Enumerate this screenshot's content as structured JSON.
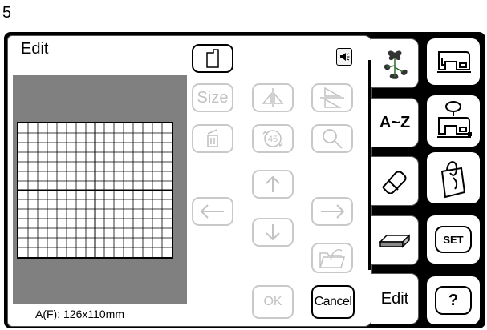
{
  "page_number": "5",
  "screen": {
    "title": "Edit",
    "size_readout": "A(F): 126x110mm",
    "buttons": {
      "size": "Size",
      "ok": "OK",
      "cancel": "Cancel",
      "rotate_angle": "45"
    },
    "tabs": {
      "text_tab": "A~Z",
      "edit_tab": "Edit"
    },
    "side_buttons": {
      "set": "SET",
      "help": "?"
    }
  },
  "icons": {
    "template": "template-icon",
    "speaker": "speaker-icon",
    "flip_horizontal": "flip-horizontal-icon",
    "flip_vertical": "flip-vertical-icon",
    "delete": "trash-icon",
    "rotate": "rotate-icon",
    "zoom": "magnifier-icon",
    "arrow_up": "arrow-up-icon",
    "arrow_down": "arrow-down-icon",
    "arrow_left": "arrow-left-icon",
    "arrow_right": "arrow-right-icon",
    "folder": "folder-icon"
  },
  "colors": {
    "preview_bg": "#808080",
    "disabled": "#c2c2c2",
    "frame": "#000000"
  }
}
